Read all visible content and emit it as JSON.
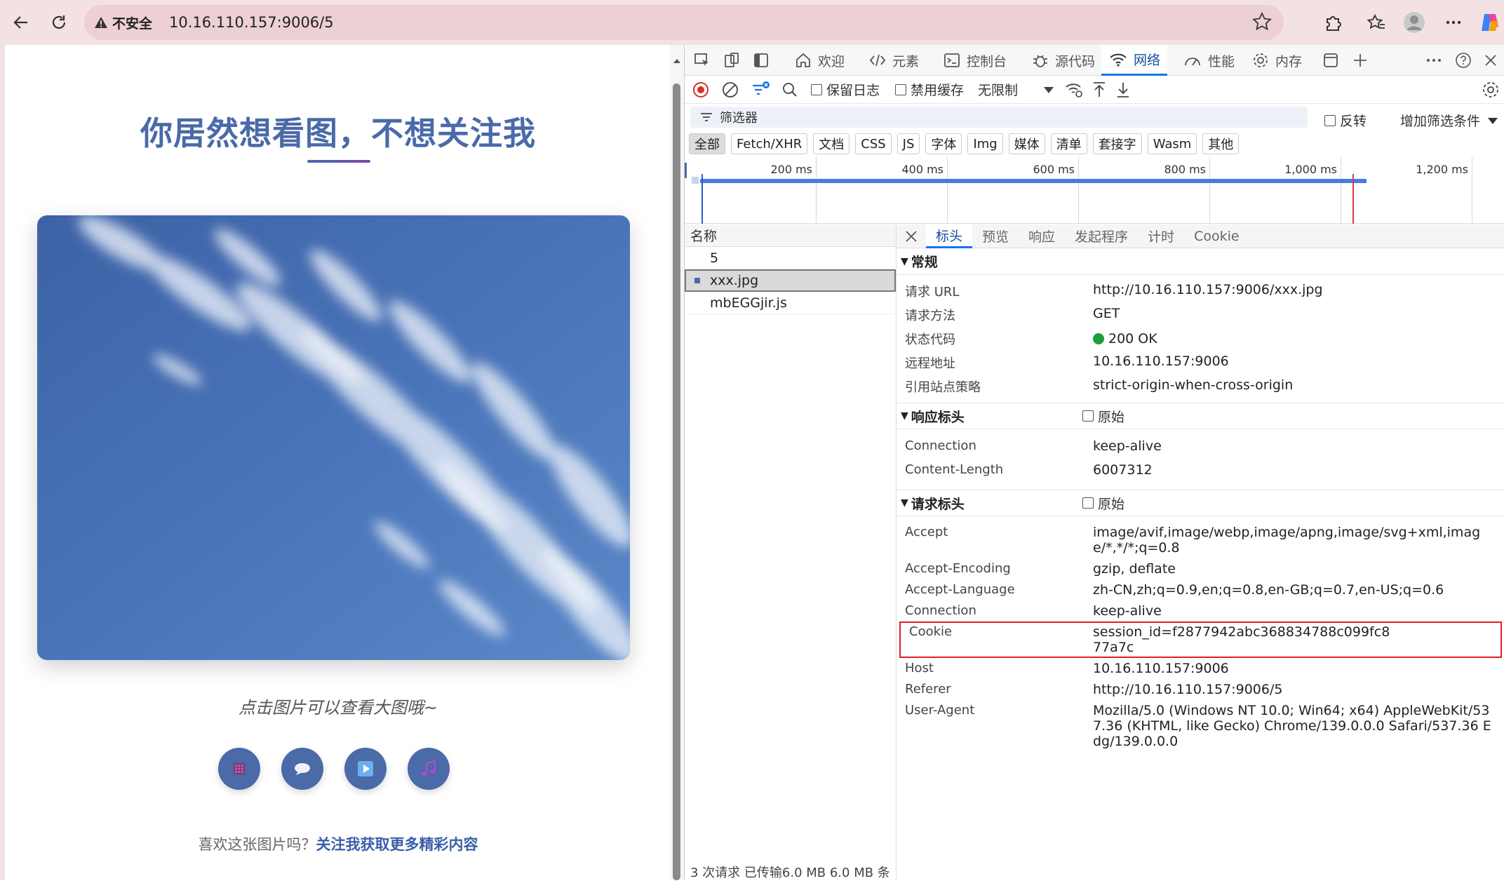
{
  "browser": {
    "security_label": "不安全",
    "url": "10.16.110.157:9006/5"
  },
  "page": {
    "title": "你居然想看图，不想关注我",
    "caption": "点击图片可以查看大图哦~",
    "footer_prefix": "喜欢这张图片吗？",
    "footer_link": "关注我获取更多精彩内容"
  },
  "devtools": {
    "tabs": [
      {
        "label": "欢迎",
        "icon": "home-icon"
      },
      {
        "label": "元素",
        "icon": "code-icon"
      },
      {
        "label": "控制台",
        "icon": "console-icon"
      },
      {
        "label": "源代码",
        "icon": "bug-icon"
      },
      {
        "label": "网络",
        "icon": "wifi-icon"
      },
      {
        "label": "性能",
        "icon": "performance-icon"
      },
      {
        "label": "内存",
        "icon": "gear-icon"
      }
    ],
    "toolbar": {
      "preserve_log": "保留日志",
      "disable_cache": "禁用缓存",
      "throttle": "无限制"
    },
    "filter": {
      "placeholder": "筛选器",
      "invert": "反转",
      "more_filters": "增加筛选条件"
    },
    "types": [
      "全部",
      "Fetch/XHR",
      "文档",
      "CSS",
      "JS",
      "字体",
      "Img",
      "媒体",
      "清单",
      "套接字",
      "Wasm",
      "其他"
    ],
    "timeline_ticks": [
      "200 ms",
      "400 ms",
      "600 ms",
      "800 ms",
      "1,000 ms",
      "1,200 ms"
    ],
    "name_header": "名称",
    "requests": [
      "5",
      "xxx.jpg",
      "mbEGGjir.js"
    ],
    "status_bar": "3 次请求   已传输6.0 MB   6.0 MB 条",
    "detail_tabs": [
      "标头",
      "预览",
      "响应",
      "发起程序",
      "计时",
      "Cookie"
    ],
    "general": {
      "title": "常规",
      "rows": [
        {
          "k": "请求 URL",
          "v": "http://10.16.110.157:9006/xxx.jpg"
        },
        {
          "k": "请求方法",
          "v": "GET"
        },
        {
          "k": "状态代码",
          "v": "200 OK"
        },
        {
          "k": "远程地址",
          "v": "10.16.110.157:9006"
        },
        {
          "k": "引用站点策略",
          "v": "strict-origin-when-cross-origin"
        }
      ]
    },
    "response_headers": {
      "title": "响应标头",
      "raw": "原始",
      "rows": [
        {
          "k": "Connection",
          "v": "keep-alive"
        },
        {
          "k": "Content-Length",
          "v": "6007312"
        }
      ]
    },
    "request_headers": {
      "title": "请求标头",
      "raw": "原始",
      "rows": [
        {
          "k": "Accept",
          "v": "image/avif,image/webp,image/apng,image/svg+xml,image/*,*/*;q=0.8"
        },
        {
          "k": "Accept-Encoding",
          "v": "gzip, deflate"
        },
        {
          "k": "Accept-Language",
          "v": "zh-CN,zh;q=0.9,en;q=0.8,en-GB;q=0.7,en-US;q=0.6"
        },
        {
          "k": "Connection",
          "v": "keep-alive"
        },
        {
          "k": "Cookie",
          "v": "session_id=f2877942abc368834788c099fc877a7c"
        },
        {
          "k": "Host",
          "v": "10.16.110.157:9006"
        },
        {
          "k": "Referer",
          "v": "http://10.16.110.157:9006/5"
        },
        {
          "k": "User-Agent",
          "v": "Mozilla/5.0 (Windows NT 10.0; Win64; x64) AppleWebKit/537.36 (KHTML, like Gecko) Chrome/139.0.0.0 Safari/537.36 Edg/139.0.0.0"
        }
      ]
    },
    "colors": {
      "accent": "#1a73e8",
      "status_ok": "#1e9e3e",
      "highlight": "#e02020"
    }
  }
}
